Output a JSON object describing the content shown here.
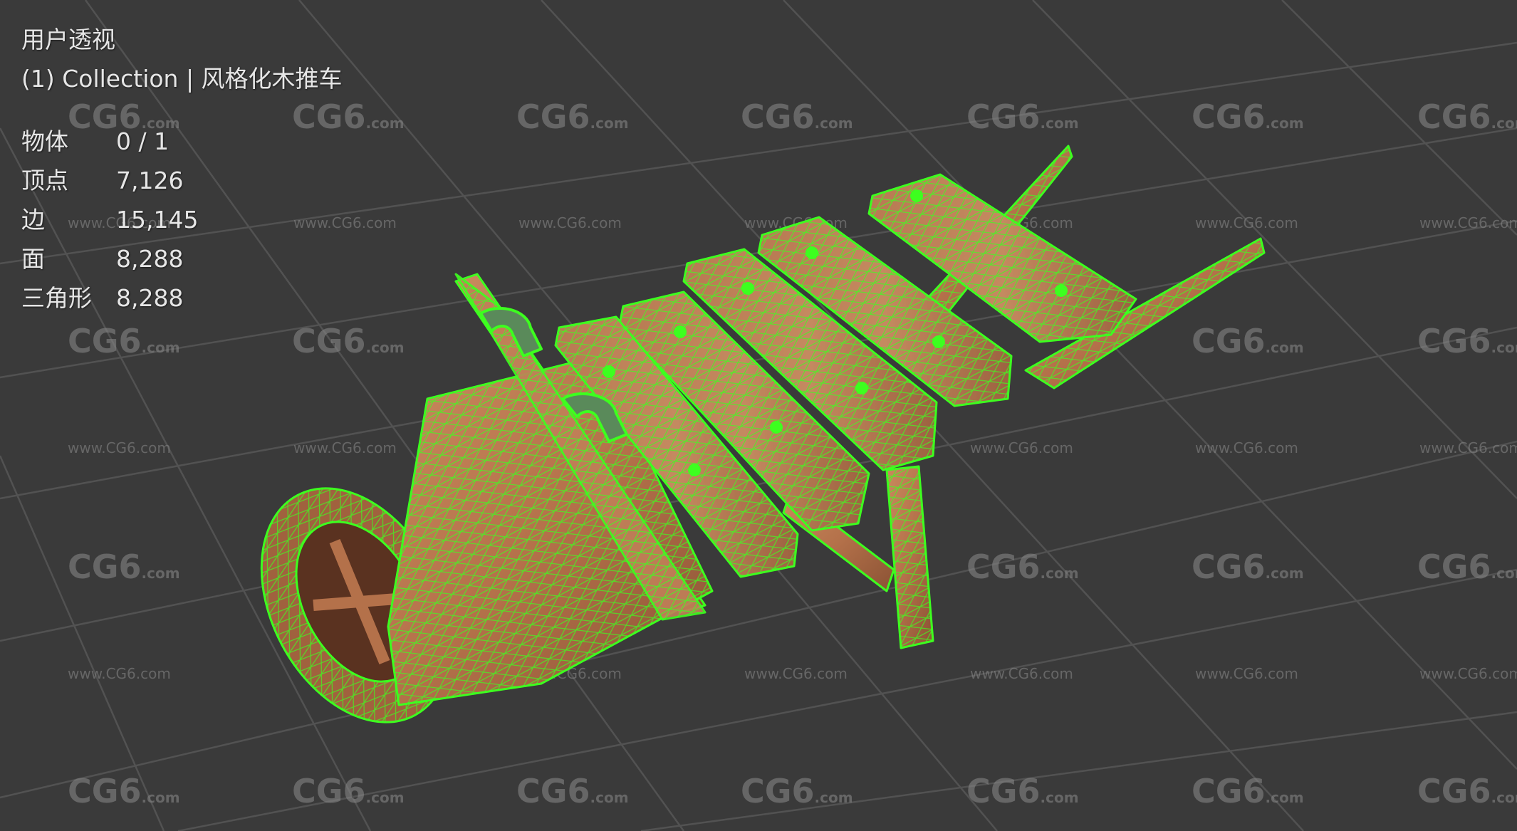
{
  "viewport": {
    "view_name": "用户透视",
    "collection_line": "(1) Collection | 风格化木推车",
    "stats": [
      {
        "label": "物体",
        "value": "0 / 1"
      },
      {
        "label": "顶点",
        "value": "7,126"
      },
      {
        "label": "边",
        "value": "15,145"
      },
      {
        "label": "面",
        "value": "8,288"
      },
      {
        "label": "三角形",
        "value": "8,288"
      }
    ]
  },
  "watermark": {
    "logo": "CG6",
    "logo_suffix": ".com",
    "url": "www.CG6.com"
  },
  "colors": {
    "background": "#3a3a3a",
    "grid": "#565656",
    "wire": "#3dff1f",
    "wood": "#b4714a",
    "wood_dark": "#7e4a2e",
    "text": "#e6e6e6"
  }
}
